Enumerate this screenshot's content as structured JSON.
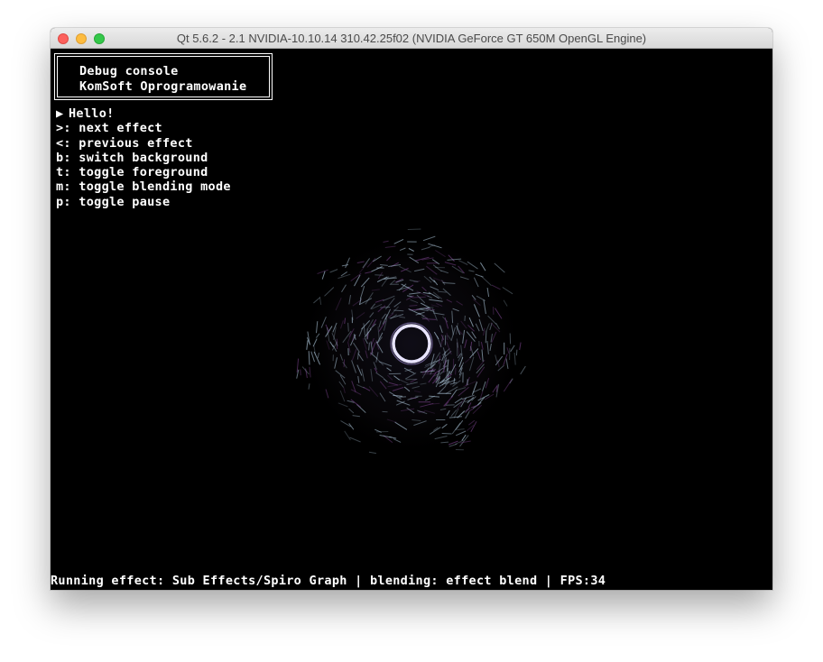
{
  "window": {
    "title": "Qt 5.6.2 - 2.1 NVIDIA-10.10.14 310.42.25f02 (NVIDIA GeForce GT 650M OpenGL Engine)"
  },
  "console": {
    "lines": [
      "Debug console",
      "KomSoft Oprogramowanie"
    ]
  },
  "menu": {
    "items": [
      {
        "marker": "▶",
        "label": "Hello!"
      },
      {
        "label": ">: next effect"
      },
      {
        "label": "<: previous effect"
      },
      {
        "label": "b: switch background"
      },
      {
        "label": "t: toggle foreground"
      },
      {
        "label": "m: toggle blending mode"
      },
      {
        "label": "p: toggle pause"
      }
    ]
  },
  "status": {
    "text": "Running effect: Sub Effects/Spiro Graph | blending: effect blend | FPS:34"
  },
  "colors": {
    "background": "#000000",
    "text": "#ffffff",
    "spiro_light": "#9fb6c8",
    "spiro_purple": "#6a3a7a",
    "ring": "#e8e4ff"
  },
  "icons": {
    "close": "close-button",
    "minimize": "minimize-button",
    "maximize": "maximize-button",
    "selection_marker": "triangle-right-icon"
  }
}
